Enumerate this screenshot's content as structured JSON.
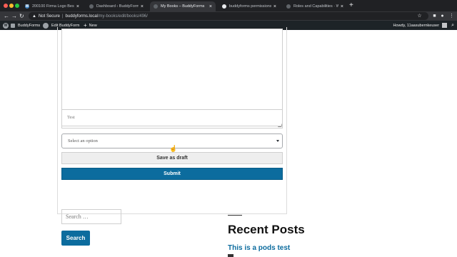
{
  "browser": {
    "tabs": [
      {
        "icon": "wordpress-icon",
        "title": "200100 Firma Logo Beschreibu",
        "active": false
      },
      {
        "icon": "page-icon",
        "title": "Dashboard ‹ BuddyForms — Wo",
        "active": false
      },
      {
        "icon": "page-icon",
        "title": "My Books – BuddyForms",
        "active": true
      },
      {
        "icon": "google-icon",
        "title": "buddyforms permissions - Goog",
        "active": false
      },
      {
        "icon": "page-icon",
        "title": "Roles and Capabilities · WordPress",
        "active": false
      }
    ],
    "close_glyph": "×",
    "new_tab_glyph": "+",
    "security_label": "Not Secure",
    "url_host": "buddyforms.local",
    "url_path": "/my-books/edit/books/496/"
  },
  "adminbar": {
    "site_name": "BuddyForms",
    "edit_label": "Edit BuddyForm",
    "new_label": "New",
    "greeting": "Howdy, 11aasubernkeuser"
  },
  "form": {
    "text_placeholder": "Test",
    "select_value": "Select an option",
    "draft_label": "Save as draft",
    "submit_label": "Submit"
  },
  "sidebar": {
    "search_placeholder": "Search …",
    "search_button": "Search",
    "recent_posts_title": "Recent Posts",
    "recent_post_1": "This is a pods test"
  },
  "colors": {
    "primary_button": "#0c6c9e",
    "adminbar": "#1d2327",
    "tabbar": "#202124"
  }
}
